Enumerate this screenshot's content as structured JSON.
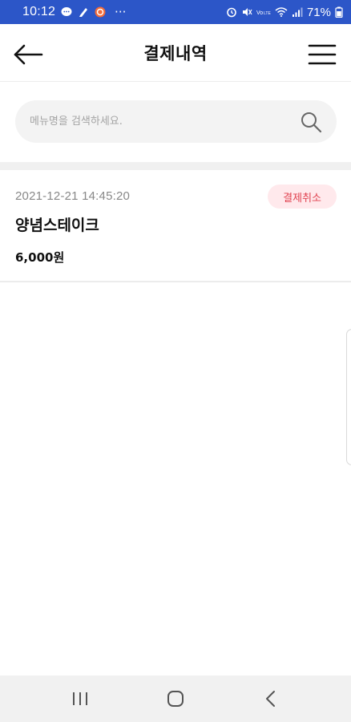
{
  "status_bar": {
    "time": "10:12",
    "more": "···",
    "battery": "71%",
    "left_icons": [
      "chat-bubble-icon",
      "pen-icon",
      "app-badge-icon"
    ],
    "right_icons": [
      "alarm-icon",
      "mute-icon",
      "volte-icon",
      "wifi-icon",
      "signal-icon",
      "battery-icon"
    ]
  },
  "header": {
    "title": "결제내역",
    "back_icon": "arrow-left-icon",
    "menu_icon": "hamburger-menu-icon"
  },
  "search": {
    "placeholder": "메뉴명을 검색하세요.",
    "value": "",
    "icon": "search-icon"
  },
  "payments": [
    {
      "date": "2021-12-21 14:45:20",
      "status": "결제취소",
      "name": "양념스테이크",
      "price": "6,000원"
    }
  ],
  "colors": {
    "status_bar": "#2c56c8",
    "cancel_badge_bg": "#ffe9ec",
    "cancel_badge_text": "#e0424f",
    "search_bg": "#f3f3f3"
  },
  "nav_bar": {
    "icons": [
      "recent-apps-icon",
      "home-icon",
      "back-icon"
    ]
  }
}
